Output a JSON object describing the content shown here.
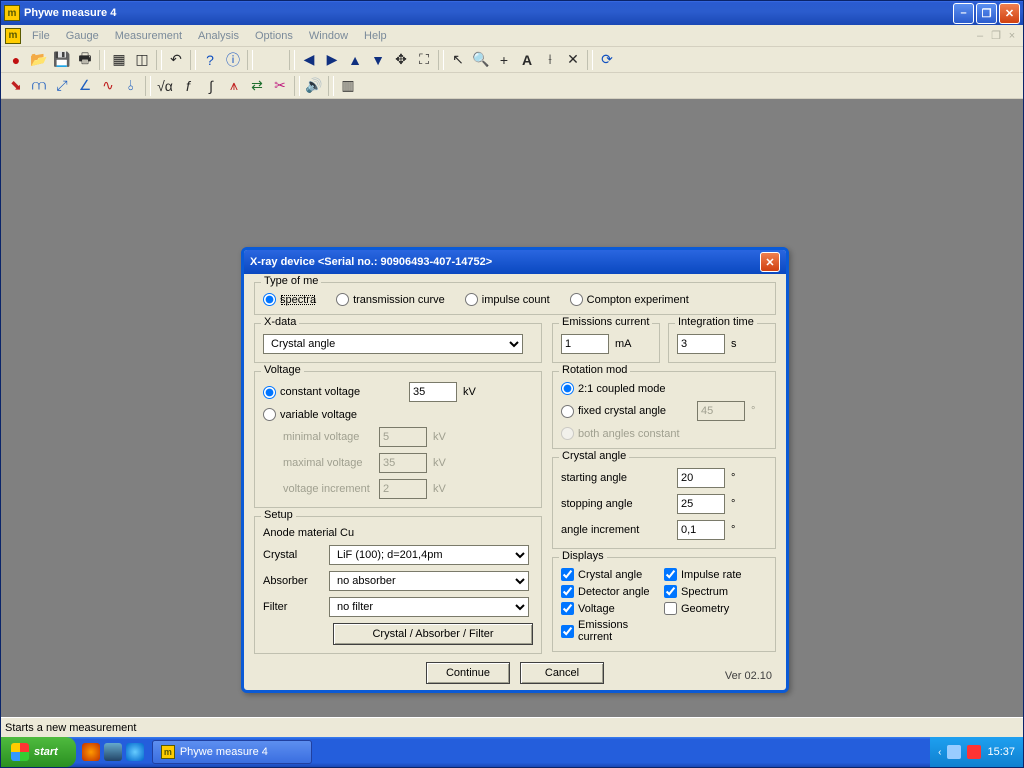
{
  "window": {
    "title": "Phywe measure 4"
  },
  "menu": {
    "file": "File",
    "gauge": "Gauge",
    "measurement": "Measurement",
    "analysis": "Analysis",
    "options": "Options",
    "window": "Window",
    "help": "Help"
  },
  "dialog": {
    "title": "X-ray device  <Serial no.: 90906493-407-14752>",
    "type_group": "Type of me",
    "types": {
      "spectra": "spectra",
      "transmission": "transmission curve",
      "impulse": "impulse count",
      "compton": "Compton experiment"
    },
    "xdata": {
      "group": "X-data",
      "selected": "Crystal angle"
    },
    "emissions": {
      "group": "Emissions current",
      "value": "1",
      "unit": "mA"
    },
    "integration": {
      "group": "Integration time",
      "value": "3",
      "unit": "s"
    },
    "voltage": {
      "group": "Voltage",
      "constant": "constant voltage",
      "constant_val": "35",
      "constant_unit": "kV",
      "variable": "variable voltage",
      "min_lbl": "minimal voltage",
      "min_val": "5",
      "max_lbl": "maximal voltage",
      "max_val": "35",
      "inc_lbl": "voltage increment",
      "inc_val": "2",
      "kv": "kV"
    },
    "rotation": {
      "group": "Rotation mod",
      "coupled": "2:1 coupled mode",
      "fixed": "fixed crystal angle",
      "fixed_val": "45",
      "fixed_unit": "°",
      "both": "both angles constant"
    },
    "crystal_angle": {
      "group": "Crystal angle",
      "start_lbl": "starting angle",
      "start_val": "20",
      "stop_lbl": "stopping angle",
      "stop_val": "25",
      "inc_lbl": "angle increment",
      "inc_val": "0,1",
      "deg": "°"
    },
    "setup": {
      "group": "Setup",
      "anode": "Anode material  Cu",
      "crystal_lbl": "Crystal",
      "crystal_val": "LiF (100); d=201,4pm",
      "absorber_lbl": "Absorber",
      "absorber_val": "no absorber",
      "filter_lbl": "Filter",
      "filter_val": "no filter",
      "caf_btn": "Crystal / Absorber / Filter"
    },
    "displays": {
      "group": "Displays",
      "crystal": "Crystal angle",
      "impulse": "Impulse rate",
      "detector": "Detector angle",
      "spectrum": "Spectrum",
      "voltage": "Voltage",
      "geometry": "Geometry",
      "emissions": "Emissions current"
    },
    "continue": "Continue",
    "cancel": "Cancel",
    "version": "Ver 02.10"
  },
  "status": {
    "text": "Starts a new measurement"
  },
  "taskbar": {
    "start": "start",
    "task": "Phywe measure 4",
    "time": "15:37"
  }
}
